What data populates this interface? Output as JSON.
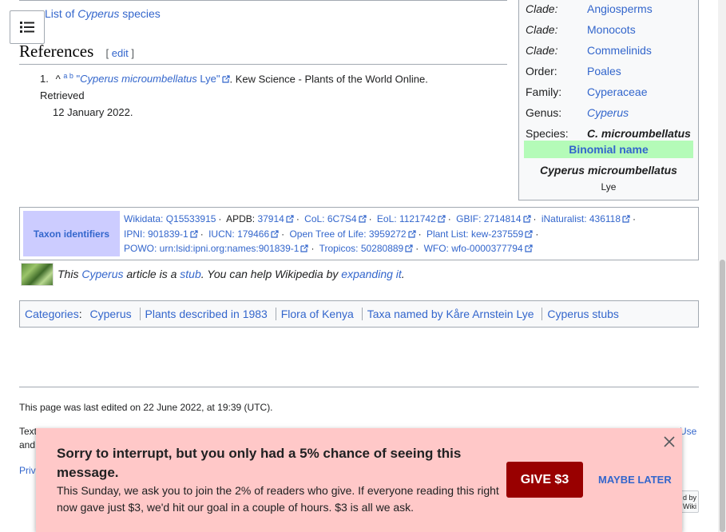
{
  "article": {
    "see_also_prefix": "List of ",
    "see_also_genus": "Cyperus",
    "see_also_suffix": " species",
    "references_heading": "References",
    "edit_label": "edit",
    "ref1": {
      "num": "1.",
      "caret": "^",
      "backrefs": "a b",
      "link_quote_open": "\"",
      "link_italic": "Cyperus microumbellatus",
      "link_rest": " Lye\"",
      "source": ". Kew Science - Plants of the World Online. Retrieved",
      "date": "12 January 2022."
    }
  },
  "infobox": {
    "rows": [
      {
        "key": "Clade:",
        "value": "Angiosperms",
        "italic_key": true,
        "link": true
      },
      {
        "key": "Clade:",
        "value": "Monocots",
        "italic_key": true,
        "link": true
      },
      {
        "key": "Clade:",
        "value": "Commelinids",
        "italic_key": true,
        "link": true
      },
      {
        "key": "Order:",
        "value": "Poales",
        "link": true
      },
      {
        "key": "Family:",
        "value": "Cyperaceae",
        "link": true
      },
      {
        "key": "Genus:",
        "value": "Cyperus",
        "link": true,
        "italic_value": true
      },
      {
        "key": "Species:",
        "value": "C. microumbellatus",
        "bold_italic": true
      }
    ],
    "binomial_header": "Binomial name",
    "binomial": "Cyperus microumbellatus",
    "authority": "Lye"
  },
  "taxon": {
    "header": "Taxon identifiers",
    "line1": [
      {
        "label": "Wikidata: ",
        "value": "Q15533915",
        "ext": false
      },
      {
        "label": "APDB: ",
        "value": "37914",
        "ext": true,
        "plain_label": true
      },
      {
        "label": "CoL: ",
        "value": "6C7S4",
        "ext": true
      },
      {
        "label": "EoL: ",
        "value": "1121742",
        "ext": true
      },
      {
        "label": "GBIF: ",
        "value": "2714814",
        "ext": true
      },
      {
        "label": "iNaturalist: ",
        "value": "436118",
        "ext": true
      }
    ],
    "line2": [
      {
        "label": "IPNI: ",
        "value": "901839-1",
        "ext": true
      },
      {
        "label": "IUCN: ",
        "value": "179466",
        "ext": true
      },
      {
        "label": "Open Tree of Life: ",
        "value": "3959272",
        "ext": true
      },
      {
        "label": "Plant List: ",
        "value": "kew-237559",
        "ext": true
      }
    ],
    "line3": [
      {
        "label": "POWO: ",
        "value": "urn:lsid:ipni.org:names:901839-1",
        "ext": true
      },
      {
        "label": "Tropicos: ",
        "value": "50280889",
        "ext": true
      },
      {
        "label": "WFO: ",
        "value": "wfo-0000377794",
        "ext": true
      }
    ]
  },
  "stub": {
    "this": "This ",
    "genus": "Cyperus",
    "mid": " article is a ",
    "stub_link": "stub",
    "mid2": ". You can help Wikipedia by ",
    "expand_link": "expanding it",
    "end": "."
  },
  "categories": {
    "label": "Categories",
    "items": [
      "Cyperus",
      "Plants described in 1983",
      "Flora of Kenya",
      "Taxa named by Kåre Arnstein Lye",
      "Cyperus stubs"
    ]
  },
  "footer": {
    "last_edited": "This page was last edited on 22 June 2022, at 19:39 (UTC).",
    "text_frag": "Text",
    "and_frag": "and",
    "privacy_frag": "Priv",
    "use_frag": "Use",
    "badge_line1": "d by",
    "badge_line2": "Wiki"
  },
  "banner": {
    "title": "Sorry to interrupt, but you only had a 5% chance of seeing this message.",
    "body": "This Sunday, we ask you to join the 2% of readers who give. If everyone reading this right now gave just $3, we'd hit our goal in a couple of hours. $3 is all we ask.",
    "give_label": "GIVE $3",
    "later_label": "MAYBE LATER"
  },
  "colors": {
    "link": "#3366cc",
    "banner_bg": "#ffc8c8",
    "give_bg": "#990000",
    "binomial_bg": "#b4fbb8",
    "taxon_header_bg": "#ccccff"
  }
}
